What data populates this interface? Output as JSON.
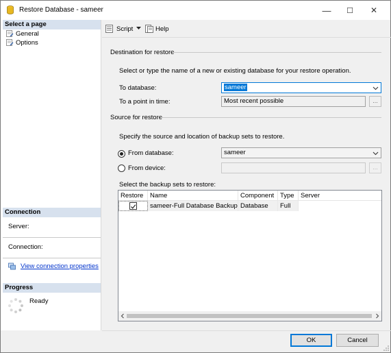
{
  "window": {
    "title": "Restore Database - sameer",
    "controls": {
      "minimize": "—",
      "maximize": "☐",
      "close": "✕"
    }
  },
  "sidebar": {
    "select_page_header": "Select a page",
    "pages": [
      {
        "label": "General",
        "icon": "page-wrench-icon"
      },
      {
        "label": "Options",
        "icon": "page-wrench-icon"
      }
    ],
    "connection_header": "Connection",
    "server_label": "Server:",
    "connection_label": "Connection:",
    "view_connection_link": "View connection properties",
    "progress_header": "Progress",
    "progress_status": "Ready"
  },
  "toolbar": {
    "script_label": "Script",
    "help_label": "Help"
  },
  "destination": {
    "group_title": "Destination for restore",
    "instructions": "Select or type the name of a new or existing database for your restore operation.",
    "to_database_label": "To database:",
    "to_database_value": "sameer",
    "point_in_time_label": "To a point in time:",
    "point_in_time_value": "Most recent possible",
    "ellipsis": "..."
  },
  "source": {
    "group_title": "Source for restore",
    "instructions": "Specify the source and location of backup sets to restore.",
    "from_database_label": "From database:",
    "from_database_value": "sameer",
    "from_database_selected": true,
    "from_device_label": "From device:",
    "from_device_value": "",
    "ellipsis": "..."
  },
  "backup_sets": {
    "label": "Select the backup sets to restore:",
    "columns": [
      "Restore",
      "Name",
      "Component",
      "Type",
      "Server"
    ],
    "rows": [
      {
        "restore": true,
        "name": "sameer-Full Database Backup",
        "component": "Database",
        "type": "Full",
        "server": ""
      }
    ]
  },
  "buttons": {
    "ok": "OK",
    "cancel": "Cancel"
  },
  "colors": {
    "section_header": "#d7e1ee",
    "selection": "#0078d7",
    "link": "#0033cc"
  }
}
